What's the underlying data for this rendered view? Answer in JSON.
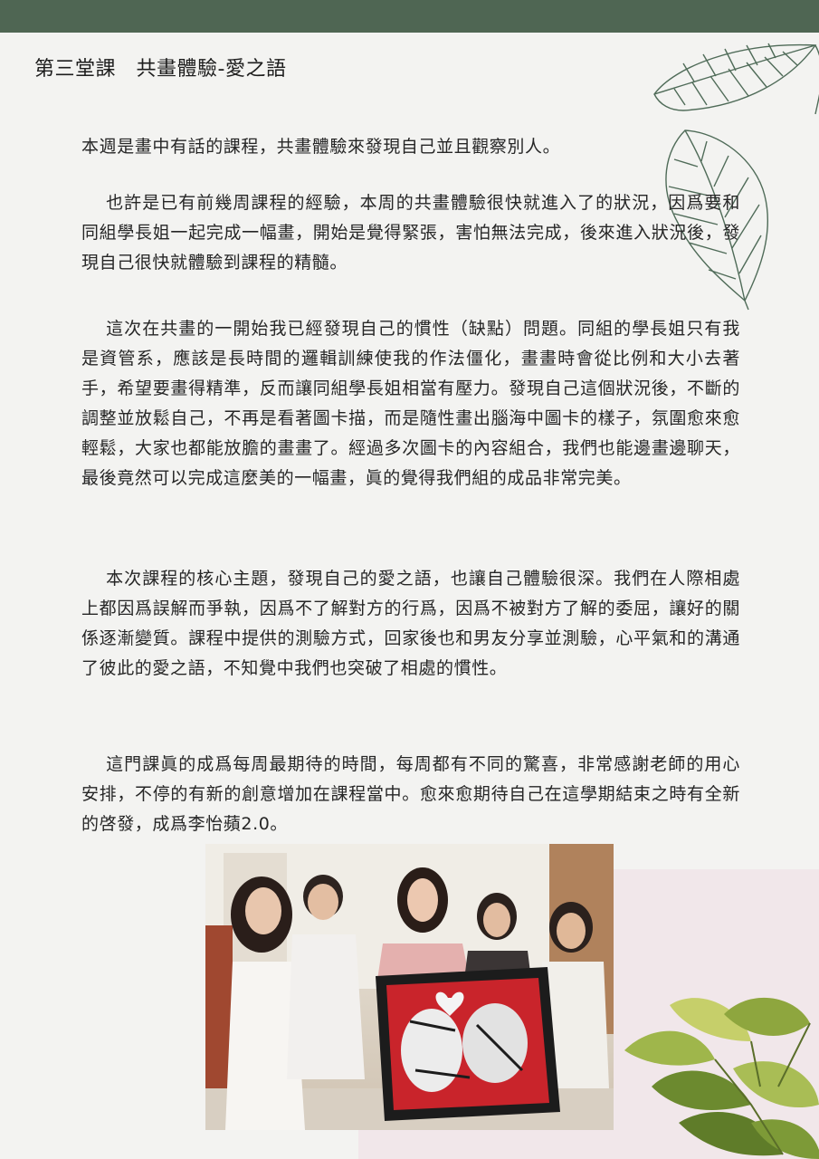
{
  "header": {
    "title": "第三堂課　共畫體驗-愛之語"
  },
  "article": {
    "paragraphs": [
      "本週是畫中有話的課程，共畫體驗來發現自己並且觀察別人。",
      "　 也許是已有前幾周課程的經驗，本周的共畫體驗很快就進入了的狀況，因爲要和同組學長姐一起完成一幅畫，開始是覺得緊張，害怕無法完成，後來進入狀況後，發現自己很快就體驗到課程的精髓。",
      "　 這次在共畫的一開始我已經發現自己的慣性（缺點）問題。同組的學長姐只有我是資管系，應該是長時間的邏輯訓練使我的作法僵化，畫畫時會從比例和大小去著手，希望要畫得精準，反而讓同組學長姐相當有壓力。發現自己這個狀況後，不斷的調整並放鬆自己，不再是看著圖卡描，而是隨性畫出腦海中圖卡的樣子，氛圍愈來愈輕鬆，大家也都能放膽的畫畫了。經過多次圖卡的內容組合，我們也能邊畫邊聊天，最後竟然可以完成這麼美的一幅畫，眞的覺得我們組的成品非常完美。",
      "　 本次課程的核心主題，發現自己的愛之語，也讓自己體驗很深。我們在人際相處上都因爲誤解而爭執，因爲不了解對方的行爲，因爲不被對方了解的委屈，讓好的關係逐漸變質。課程中提供的測驗方式，回家後也和男友分享並測驗，心平氣和的溝通了彼此的愛之語，不知覺中我們也突破了相處的慣性。",
      "　 這門課眞的成爲每周最期待的時間，每周都有不同的驚喜，非常感謝老師的用心安排，不停的有新的創意增加在課程當中。愈來愈期待自己在這學期結束之時有全新的啓發，成爲李怡蘋2.0。"
    ]
  },
  "colors": {
    "topbar": "#4f6653",
    "leaf_line": "#4f6b58",
    "pink_panel": "#f1e7ea"
  },
  "decor": {
    "leaves": "line-art-leaves-illustration",
    "plant": "green-plant-leaves-photo",
    "photo": "group-photo-five-women-holding-painting"
  }
}
